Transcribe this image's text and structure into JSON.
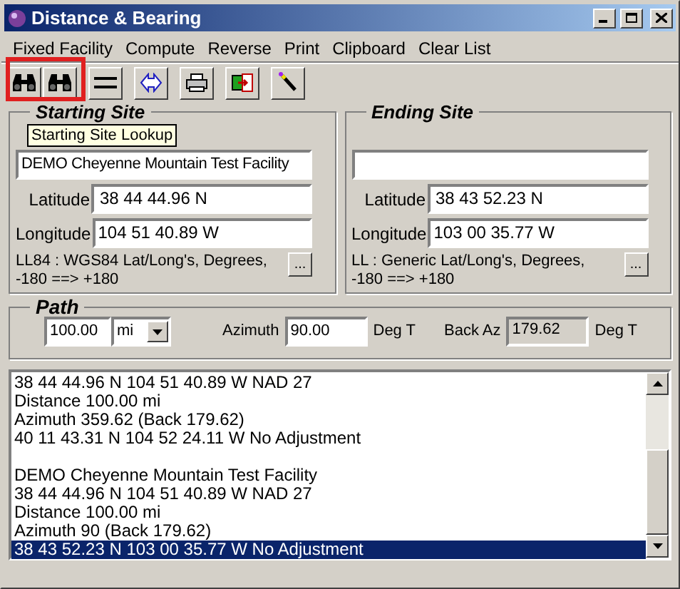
{
  "window": {
    "title": "Distance & Bearing"
  },
  "menu": [
    "Fixed Facility",
    "Compute",
    "Reverse",
    "Print",
    "Clipboard",
    "Clear List"
  ],
  "tooltip": "Starting Site Lookup",
  "sites": [
    {
      "title": "Starting Site",
      "name": "DEMO Cheyenne Mountain Test Facility",
      "latitude_label": "Latitude",
      "latitude": "38 44 44.96 N",
      "longitude_label": "Longitude",
      "longitude": "104 51 40.89 W",
      "datum": "LL84 : WGS84 Lat/Long's, Degrees, -180 ==> +180",
      "button": "..."
    },
    {
      "title": "Ending Site",
      "latitude_label": "Latitude",
      "latitude": "38 43 52.23 N",
      "longitude_label": "Longitude",
      "longitude": "103 00 35.77 W",
      "datum": "LL : Generic Lat/Long's, Degrees, -180 ==> +180",
      "button": "..."
    }
  ],
  "path": {
    "title": "Path",
    "distance": "100.00",
    "unit": "mi",
    "azimuth_label": "Azimuth",
    "azimuth": "90.00",
    "azimuth_unit": "Deg T",
    "back_az_label": "Back Az",
    "back_az": "179.62",
    "back_az_unit": "Deg T"
  },
  "results": [
    {
      "lines": [
        {
          "text": "38 44 44.96 N 104 51 40.89 W NAD 27",
          "selected": false
        },
        {
          "text": "Distance 100.00 mi",
          "selected": false
        },
        {
          "text": "Azimuth  359.62 (Back 179.62)",
          "selected": false
        },
        {
          "text": "40 11 43.31 N 104 52 24.11 W No Adjustment",
          "selected": false
        }
      ]
    },
    {
      "lines": [
        {
          "text": "DEMO Cheyenne Mountain Test Facility",
          "selected": false
        },
        {
          "text": "38 44 44.96 N 104 51 40.89 W NAD 27",
          "selected": false
        },
        {
          "text": "Distance 100.00 mi",
          "selected": false
        },
        {
          "text": "Azimuth  90 (Back 179.62)",
          "selected": false
        },
        {
          "text": "38 43 52.23 N 103 00 35.77 W No Adjustment",
          "selected": true
        }
      ]
    }
  ]
}
